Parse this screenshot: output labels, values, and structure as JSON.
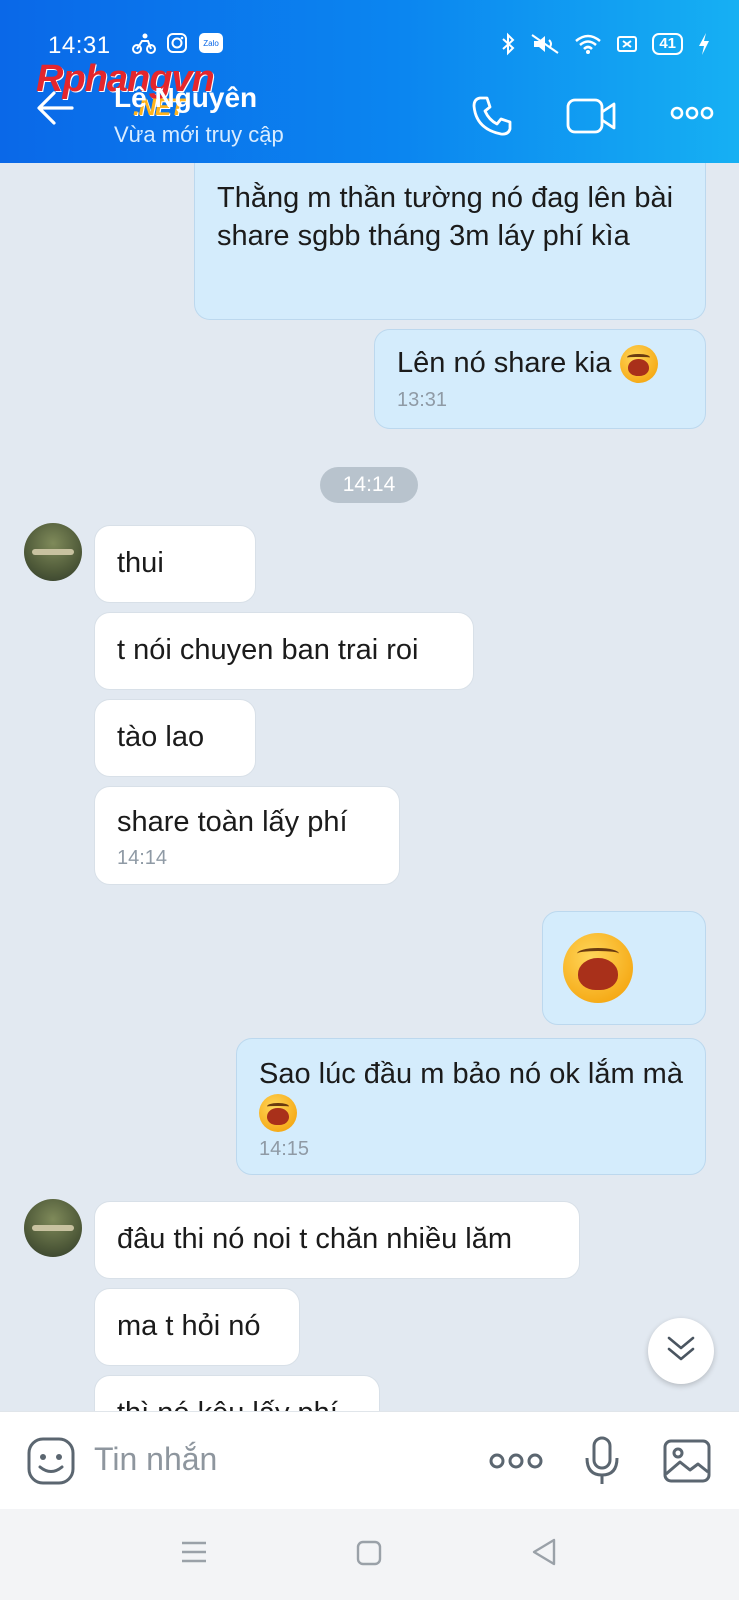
{
  "status_bar": {
    "time": "14:31",
    "battery": "41",
    "app_label": "Zalo"
  },
  "watermark": {
    "main": "Rphangvn",
    "sub": ".NET"
  },
  "header": {
    "contact_name": "Lê Nguyên",
    "contact_status": "Vừa mới truy cập"
  },
  "messages": [
    {
      "side": "me",
      "text": "Thằng m thần tường nó đag lên bài share sgbb tháng 3m láy phí kìa",
      "time": ""
    },
    {
      "side": "me",
      "text": "Lên nó share kia",
      "time": "13:31"
    },
    {
      "side": "them",
      "text": "thui",
      "time": ""
    },
    {
      "side": "them",
      "text": "t nói chuyen ban trai roi",
      "time": ""
    },
    {
      "side": "them",
      "text": "tào lao",
      "time": ""
    },
    {
      "side": "them",
      "text": "share toàn lấy phí",
      "time": "14:14"
    },
    {
      "side": "me",
      "text": "",
      "time": ""
    },
    {
      "side": "me",
      "text": "Sao lúc đầu m bảo nó ok lắm mà",
      "time": "14:15"
    },
    {
      "side": "them",
      "text": "đâu thi nó noi t chăn nhiều lăm",
      "time": ""
    },
    {
      "side": "them",
      "text": "ma t hỏi nó",
      "time": ""
    },
    {
      "side": "them",
      "text": "thì nó kêu lấy phí",
      "time": ""
    }
  ],
  "date_divider": "14:14",
  "composer": {
    "placeholder": "Tin nhắn"
  },
  "colors": {
    "header_start": "#0a68e8",
    "header_end": "#16b0f3",
    "my_bubble": "#d4ecfc",
    "their_bubble": "#ffffff",
    "chat_bg": "#e2e9f1"
  },
  "icons": [
    "back-arrow-icon",
    "phone-icon",
    "video-icon",
    "more-icon",
    "sticker-icon",
    "mic-icon",
    "image-icon",
    "chevron-down-icon"
  ]
}
